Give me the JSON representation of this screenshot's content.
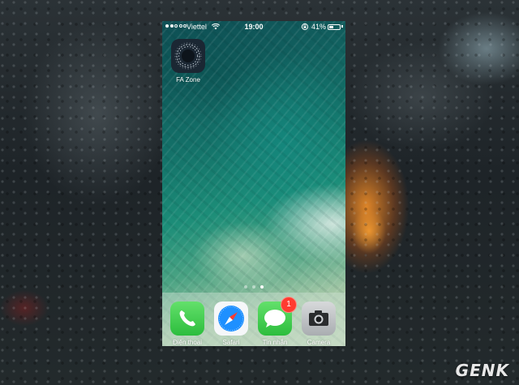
{
  "status_bar": {
    "signal_bars_filled": 2,
    "signal_bars_total": 5,
    "carrier": "Viettel",
    "time": "19:00",
    "battery_percent": "41%",
    "battery_level": 0.41
  },
  "home_apps": [
    {
      "label": "FA Zone",
      "icon": "fa-zone-icon"
    }
  ],
  "page_indicator": {
    "pages": 3,
    "active": 2
  },
  "dock_apps": [
    {
      "label": "Điện thoại",
      "icon": "phone-icon"
    },
    {
      "label": "Safari",
      "icon": "safari-icon"
    },
    {
      "label": "Tin nhắn",
      "icon": "messages-icon",
      "badge": "1"
    },
    {
      "label": "Camera",
      "icon": "camera-icon"
    }
  ],
  "watermark": "GENK",
  "colors": {
    "badge": "#ff3b30",
    "dock_green": "#2cbd3d"
  }
}
